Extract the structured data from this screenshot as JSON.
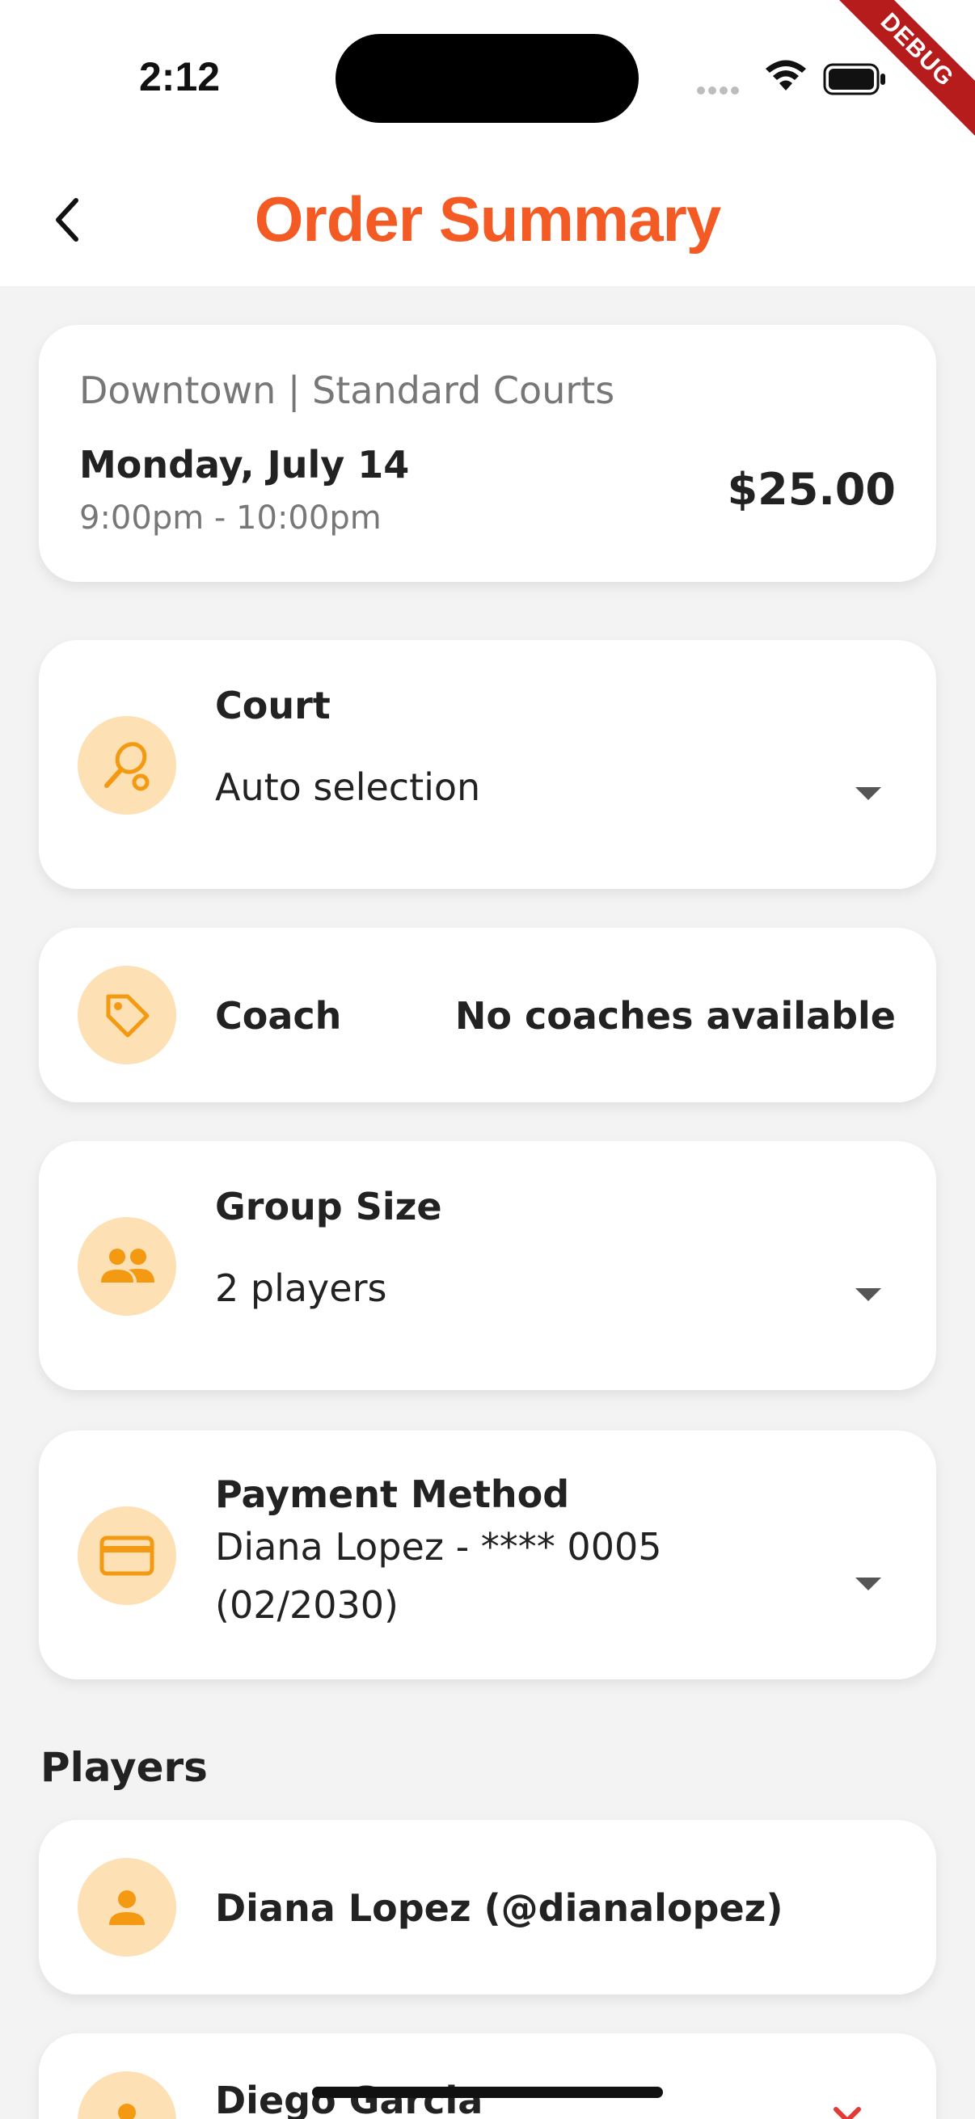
{
  "status": {
    "time": "2:12",
    "debug_label": "DEBUG"
  },
  "appbar": {
    "title": "Order Summary"
  },
  "venue": {
    "location": "Downtown | Standard Courts",
    "date": "Monday, July 14",
    "time_range": "9:00pm - 10:00pm",
    "price": "$25.00"
  },
  "court": {
    "label": "Court",
    "value": "Auto selection"
  },
  "coach": {
    "label": "Coach",
    "value": "No coaches available"
  },
  "group_size": {
    "label": "Group Size",
    "value": "2 players"
  },
  "payment": {
    "label": "Payment Method",
    "value": "Diana Lopez - **** 0005 (02/2030)"
  },
  "players": {
    "heading": "Players",
    "items": [
      {
        "name": "Diana Lopez (@dianalopez)"
      },
      {
        "name": "Diego Garcia"
      }
    ]
  },
  "colors": {
    "accent": "#f35a24",
    "icon_bg": "#fde0b3",
    "icon_fg": "#f39a12"
  },
  "icons": [
    "back-arrow-icon",
    "tennis-racket-icon",
    "tag-icon",
    "group-icon",
    "credit-card-icon",
    "person-icon",
    "close-icon"
  ]
}
